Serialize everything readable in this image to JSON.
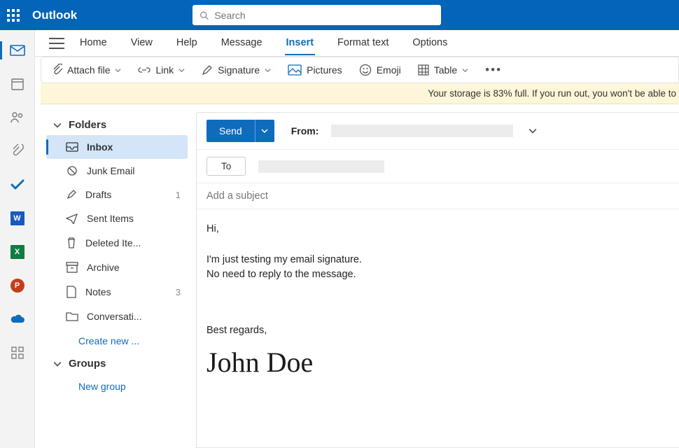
{
  "brand": "Outlook",
  "search": {
    "placeholder": "Search"
  },
  "rail": {
    "apps": [
      {
        "id": "word",
        "label": "W",
        "bg": "#185abd"
      },
      {
        "id": "excel",
        "label": "X",
        "bg": "#107c41"
      },
      {
        "id": "powerpoint",
        "label": "P",
        "bg": "#c43e1c"
      }
    ]
  },
  "menu": {
    "tabs": [
      "Home",
      "View",
      "Help",
      "Message",
      "Insert",
      "Format text",
      "Options"
    ],
    "active": "Insert"
  },
  "ribbon": {
    "attach": "Attach file",
    "link": "Link",
    "signature": "Signature",
    "pictures": "Pictures",
    "emoji": "Emoji",
    "table": "Table"
  },
  "banner": "Your storage is 83% full. If you run out, you won't be able to",
  "folders": {
    "header": "Folders",
    "items": [
      {
        "id": "inbox",
        "label": "Inbox",
        "active": true
      },
      {
        "id": "junk",
        "label": "Junk Email"
      },
      {
        "id": "drafts",
        "label": "Drafts",
        "badge": "1"
      },
      {
        "id": "sent",
        "label": "Sent Items"
      },
      {
        "id": "deleted",
        "label": "Deleted Ite..."
      },
      {
        "id": "archive",
        "label": "Archive"
      },
      {
        "id": "notes",
        "label": "Notes",
        "badge": "3"
      },
      {
        "id": "conv",
        "label": "Conversati..."
      }
    ],
    "create": "Create new ...",
    "groups": "Groups",
    "newgroup": "New group"
  },
  "compose": {
    "send": "Send",
    "from_label": "From:",
    "to_label": "To",
    "subject_placeholder": "Add a subject",
    "body": {
      "greeting": "Hi,",
      "line1": "I'm just testing my email signature.",
      "line2": "No need to reply to the message.",
      "regards": "Best regards,",
      "signature_name": "John Doe"
    }
  }
}
